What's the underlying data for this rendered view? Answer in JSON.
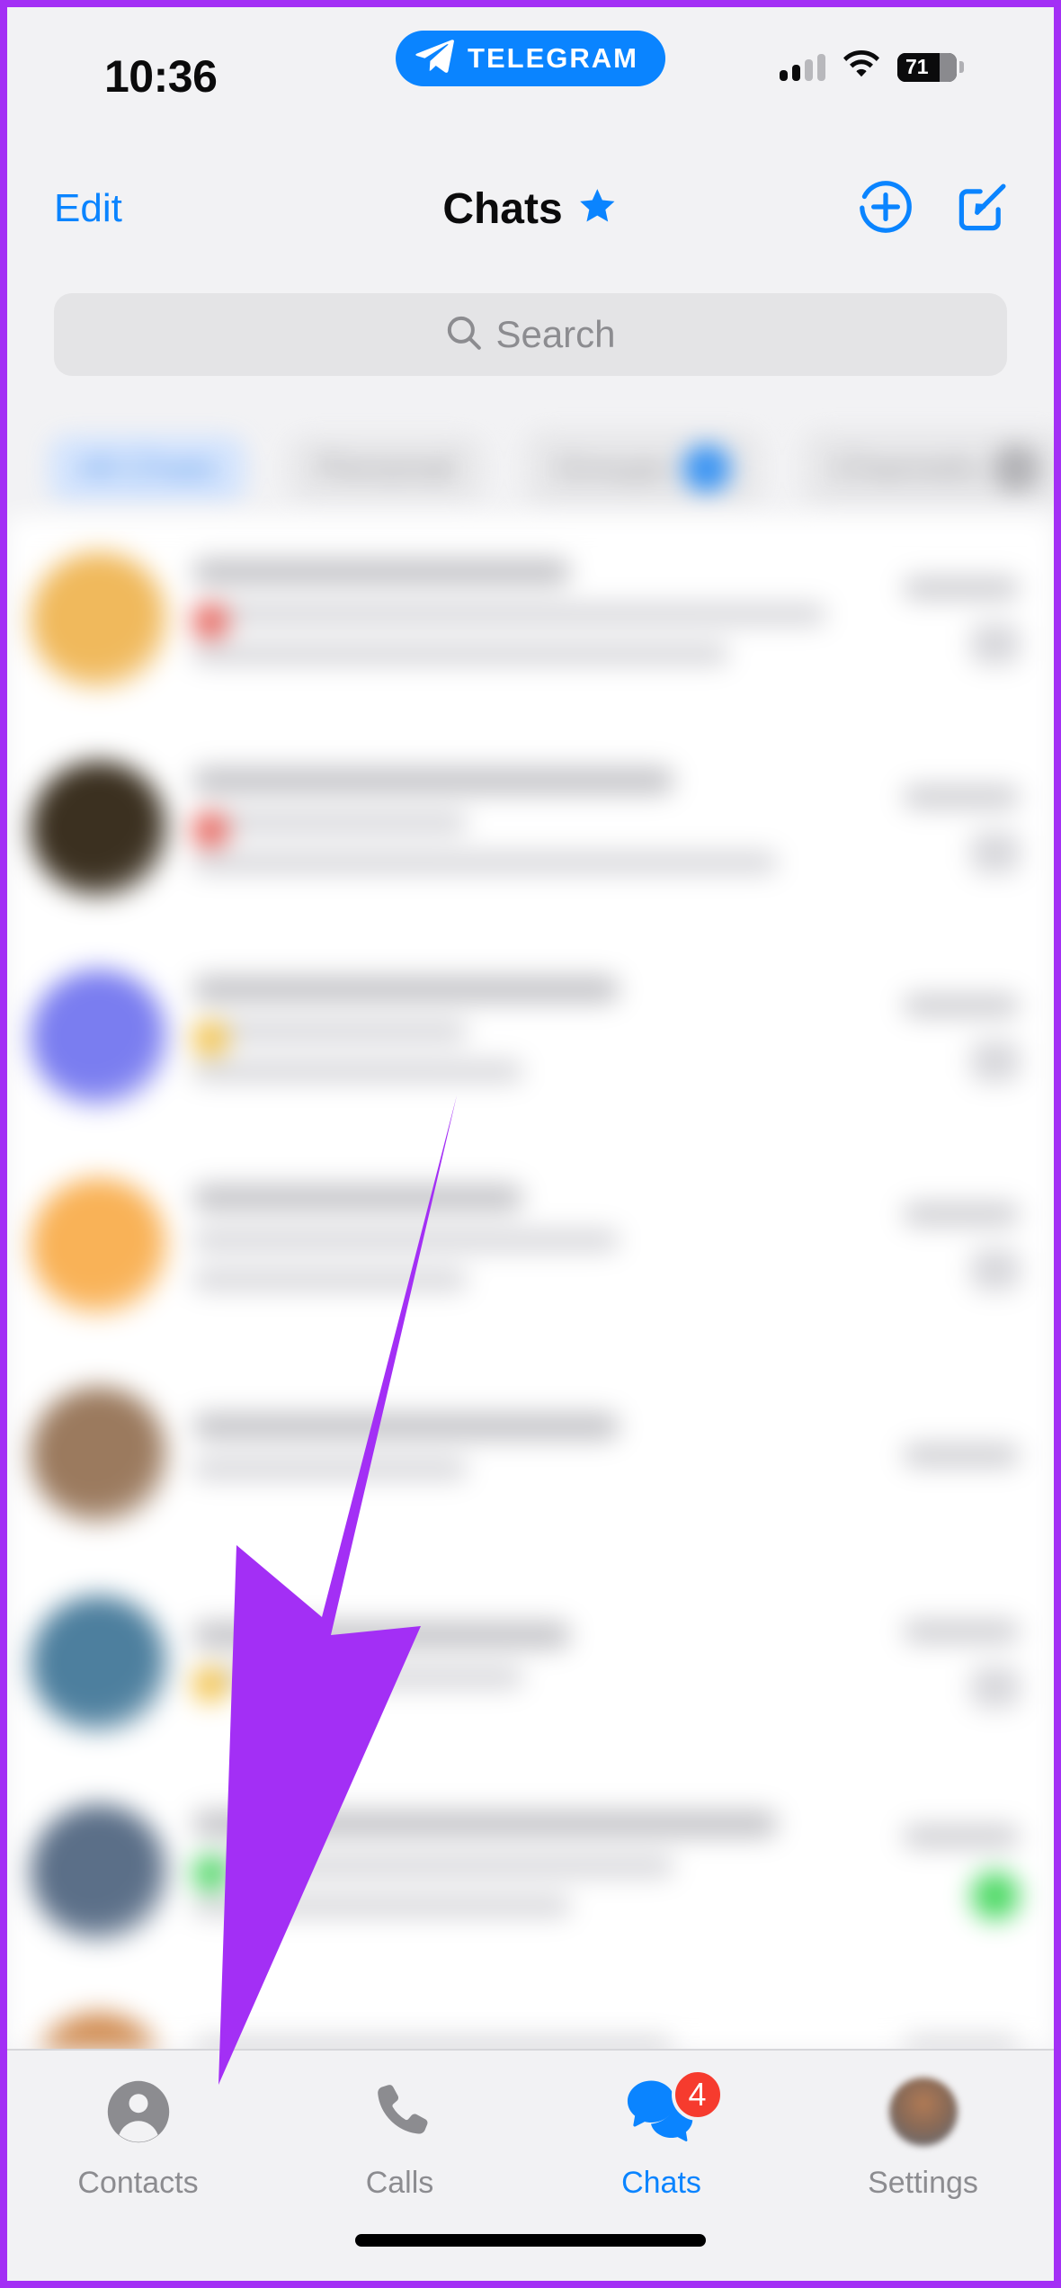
{
  "meta": {
    "app": "Telegram",
    "platform": "iOS",
    "accent_blue": "#0a84ff",
    "badge_red": "#f63b2e",
    "annotation_purple": "#a32ff5",
    "background": "#f2f2f4"
  },
  "status_bar": {
    "time": "10:36",
    "app_pill_label": "TELEGRAM",
    "app_pill_icon": "telegram-paper-plane-icon",
    "signal_icon": "cellular-signal-icon",
    "wifi_icon": "wifi-icon",
    "battery_percent": "71",
    "battery_level": 71
  },
  "nav_bar": {
    "edit_label": "Edit",
    "title": "Chats",
    "title_star_icon": "premium-star-icon",
    "add_story_icon": "add-story-plus-icon",
    "compose_icon": "compose-new-message-icon"
  },
  "search": {
    "placeholder": "Search",
    "icon": "search-icon",
    "value": ""
  },
  "filters": [
    {
      "label": "All Chats",
      "active": true,
      "badge": ""
    },
    {
      "label": "Personal",
      "active": false,
      "badge": ""
    },
    {
      "label": "Groups",
      "active": false,
      "badge": "dot-blue"
    },
    {
      "label": "Channels",
      "active": false,
      "badge": "dot-grey"
    }
  ],
  "chats": [
    {
      "avatar": "#f0b95c",
      "tinted": false,
      "title_w": "w55",
      "sub1_w": "w92",
      "sub2_w": "w78",
      "meta": "stamp",
      "mark": "pill",
      "tag": "red"
    },
    {
      "avatar": "#3b3020",
      "tinted": false,
      "title_w": "w70",
      "sub1_w": "w40",
      "sub2_w": "w85",
      "meta": "stamp",
      "mark": "pill",
      "tag": "red"
    },
    {
      "avatar": "#7a7df0",
      "tinted": false,
      "title_w": "w62",
      "sub1_w": "w40",
      "sub2_w": "w48",
      "meta": "stamp",
      "mark": "pill",
      "tag": "yellow"
    },
    {
      "avatar": "#f9b257",
      "tinted": false,
      "title_w": "w48",
      "sub1_w": "w62",
      "sub2_w": "w40",
      "meta": "stamp",
      "mark": "pill",
      "tag": ""
    },
    {
      "avatar": "#9b7a5e",
      "tinted": false,
      "title_w": "w62",
      "sub1_w": "w40",
      "sub2_w": "",
      "meta": "stamp",
      "mark": "",
      "tag": ""
    },
    {
      "avatar": "#4d7f9e",
      "tinted": false,
      "title_w": "w55",
      "sub1_w": "w48",
      "sub2_w": "",
      "meta": "stamp",
      "mark": "pill",
      "tag": "yellow"
    },
    {
      "avatar": "#5b6f88",
      "tinted": false,
      "title_w": "w85",
      "sub1_w": "w70",
      "sub2_w": "w55",
      "meta": "stamp",
      "mark": "greenmark",
      "tag": "green"
    },
    {
      "avatar": "#d08a4e",
      "tinted": false,
      "title_w": "w70",
      "sub1_w": "w55",
      "sub2_w": "",
      "meta": "stamp",
      "mark": "pill",
      "tag": ""
    }
  ],
  "annotation": {
    "type": "arrow",
    "color": "#a32ff5",
    "points_to": "Contacts tab"
  },
  "tab_bar": {
    "items": [
      {
        "label": "Contacts",
        "icon": "contacts-person-icon",
        "active": false,
        "badge": ""
      },
      {
        "label": "Calls",
        "icon": "calls-phone-icon",
        "active": false,
        "badge": ""
      },
      {
        "label": "Chats",
        "icon": "chats-bubbles-icon",
        "active": true,
        "badge": "4"
      },
      {
        "label": "Settings",
        "icon": "settings-avatar-icon",
        "active": false,
        "badge": ""
      }
    ]
  }
}
